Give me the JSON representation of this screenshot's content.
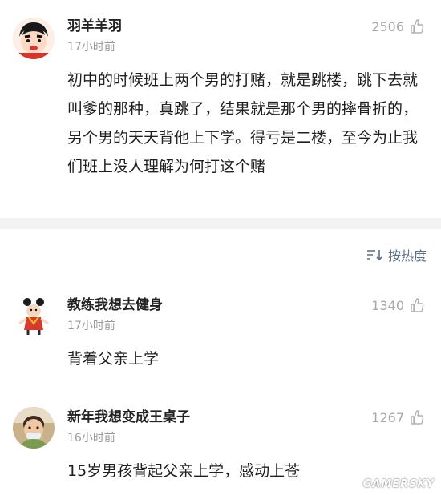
{
  "comments": [
    {
      "username": "羽羊羊羽",
      "time": "17小时前",
      "likes": "2506",
      "text": "初中的时候班上两个男的打赌，就是跳楼，跳下去就叫爹的那种，真跳了，结果就是那个男的摔骨折的，另个男的天天背他上下学。得亏是二楼，至今为止我们班上没人理解为何打这个赌",
      "avatar_icon": "cartoon-boy-avatar"
    },
    {
      "username": "教练我想去健身",
      "time": "17小时前",
      "likes": "1340",
      "text": "背着父亲上学",
      "avatar_icon": "cartoon-character-avatar"
    },
    {
      "username": "新年我想变成王桌子",
      "time": "16小时前",
      "likes": "1267",
      "text": "15岁男孩背起父亲上学，感动上苍",
      "avatar_icon": "child-photo-avatar"
    }
  ],
  "sort": {
    "label": "按热度",
    "icon": "sort-icon"
  },
  "watermark": "GAMERSKY",
  "colors": {
    "accent": "#5c6d86",
    "muted": "#9a9a9a",
    "separator": "#f3f3f3"
  }
}
